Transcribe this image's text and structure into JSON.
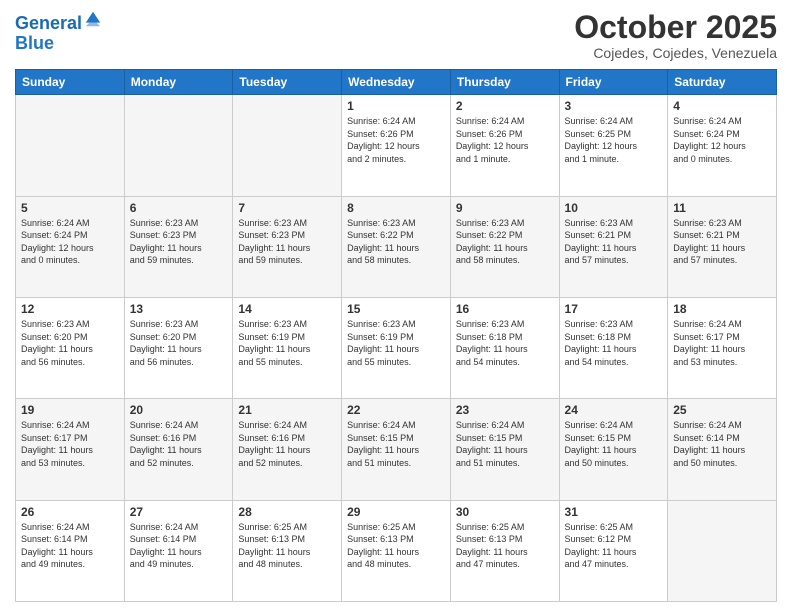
{
  "header": {
    "logo_line1": "General",
    "logo_line2": "Blue",
    "month": "October 2025",
    "location": "Cojedes, Cojedes, Venezuela"
  },
  "days_of_week": [
    "Sunday",
    "Monday",
    "Tuesday",
    "Wednesday",
    "Thursday",
    "Friday",
    "Saturday"
  ],
  "weeks": [
    [
      {
        "num": "",
        "info": ""
      },
      {
        "num": "",
        "info": ""
      },
      {
        "num": "",
        "info": ""
      },
      {
        "num": "1",
        "info": "Sunrise: 6:24 AM\nSunset: 6:26 PM\nDaylight: 12 hours\nand 2 minutes."
      },
      {
        "num": "2",
        "info": "Sunrise: 6:24 AM\nSunset: 6:26 PM\nDaylight: 12 hours\nand 1 minute."
      },
      {
        "num": "3",
        "info": "Sunrise: 6:24 AM\nSunset: 6:25 PM\nDaylight: 12 hours\nand 1 minute."
      },
      {
        "num": "4",
        "info": "Sunrise: 6:24 AM\nSunset: 6:24 PM\nDaylight: 12 hours\nand 0 minutes."
      }
    ],
    [
      {
        "num": "5",
        "info": "Sunrise: 6:24 AM\nSunset: 6:24 PM\nDaylight: 12 hours\nand 0 minutes."
      },
      {
        "num": "6",
        "info": "Sunrise: 6:23 AM\nSunset: 6:23 PM\nDaylight: 11 hours\nand 59 minutes."
      },
      {
        "num": "7",
        "info": "Sunrise: 6:23 AM\nSunset: 6:23 PM\nDaylight: 11 hours\nand 59 minutes."
      },
      {
        "num": "8",
        "info": "Sunrise: 6:23 AM\nSunset: 6:22 PM\nDaylight: 11 hours\nand 58 minutes."
      },
      {
        "num": "9",
        "info": "Sunrise: 6:23 AM\nSunset: 6:22 PM\nDaylight: 11 hours\nand 58 minutes."
      },
      {
        "num": "10",
        "info": "Sunrise: 6:23 AM\nSunset: 6:21 PM\nDaylight: 11 hours\nand 57 minutes."
      },
      {
        "num": "11",
        "info": "Sunrise: 6:23 AM\nSunset: 6:21 PM\nDaylight: 11 hours\nand 57 minutes."
      }
    ],
    [
      {
        "num": "12",
        "info": "Sunrise: 6:23 AM\nSunset: 6:20 PM\nDaylight: 11 hours\nand 56 minutes."
      },
      {
        "num": "13",
        "info": "Sunrise: 6:23 AM\nSunset: 6:20 PM\nDaylight: 11 hours\nand 56 minutes."
      },
      {
        "num": "14",
        "info": "Sunrise: 6:23 AM\nSunset: 6:19 PM\nDaylight: 11 hours\nand 55 minutes."
      },
      {
        "num": "15",
        "info": "Sunrise: 6:23 AM\nSunset: 6:19 PM\nDaylight: 11 hours\nand 55 minutes."
      },
      {
        "num": "16",
        "info": "Sunrise: 6:23 AM\nSunset: 6:18 PM\nDaylight: 11 hours\nand 54 minutes."
      },
      {
        "num": "17",
        "info": "Sunrise: 6:23 AM\nSunset: 6:18 PM\nDaylight: 11 hours\nand 54 minutes."
      },
      {
        "num": "18",
        "info": "Sunrise: 6:24 AM\nSunset: 6:17 PM\nDaylight: 11 hours\nand 53 minutes."
      }
    ],
    [
      {
        "num": "19",
        "info": "Sunrise: 6:24 AM\nSunset: 6:17 PM\nDaylight: 11 hours\nand 53 minutes."
      },
      {
        "num": "20",
        "info": "Sunrise: 6:24 AM\nSunset: 6:16 PM\nDaylight: 11 hours\nand 52 minutes."
      },
      {
        "num": "21",
        "info": "Sunrise: 6:24 AM\nSunset: 6:16 PM\nDaylight: 11 hours\nand 52 minutes."
      },
      {
        "num": "22",
        "info": "Sunrise: 6:24 AM\nSunset: 6:15 PM\nDaylight: 11 hours\nand 51 minutes."
      },
      {
        "num": "23",
        "info": "Sunrise: 6:24 AM\nSunset: 6:15 PM\nDaylight: 11 hours\nand 51 minutes."
      },
      {
        "num": "24",
        "info": "Sunrise: 6:24 AM\nSunset: 6:15 PM\nDaylight: 11 hours\nand 50 minutes."
      },
      {
        "num": "25",
        "info": "Sunrise: 6:24 AM\nSunset: 6:14 PM\nDaylight: 11 hours\nand 50 minutes."
      }
    ],
    [
      {
        "num": "26",
        "info": "Sunrise: 6:24 AM\nSunset: 6:14 PM\nDaylight: 11 hours\nand 49 minutes."
      },
      {
        "num": "27",
        "info": "Sunrise: 6:24 AM\nSunset: 6:14 PM\nDaylight: 11 hours\nand 49 minutes."
      },
      {
        "num": "28",
        "info": "Sunrise: 6:25 AM\nSunset: 6:13 PM\nDaylight: 11 hours\nand 48 minutes."
      },
      {
        "num": "29",
        "info": "Sunrise: 6:25 AM\nSunset: 6:13 PM\nDaylight: 11 hours\nand 48 minutes."
      },
      {
        "num": "30",
        "info": "Sunrise: 6:25 AM\nSunset: 6:13 PM\nDaylight: 11 hours\nand 47 minutes."
      },
      {
        "num": "31",
        "info": "Sunrise: 6:25 AM\nSunset: 6:12 PM\nDaylight: 11 hours\nand 47 minutes."
      },
      {
        "num": "",
        "info": ""
      }
    ]
  ]
}
